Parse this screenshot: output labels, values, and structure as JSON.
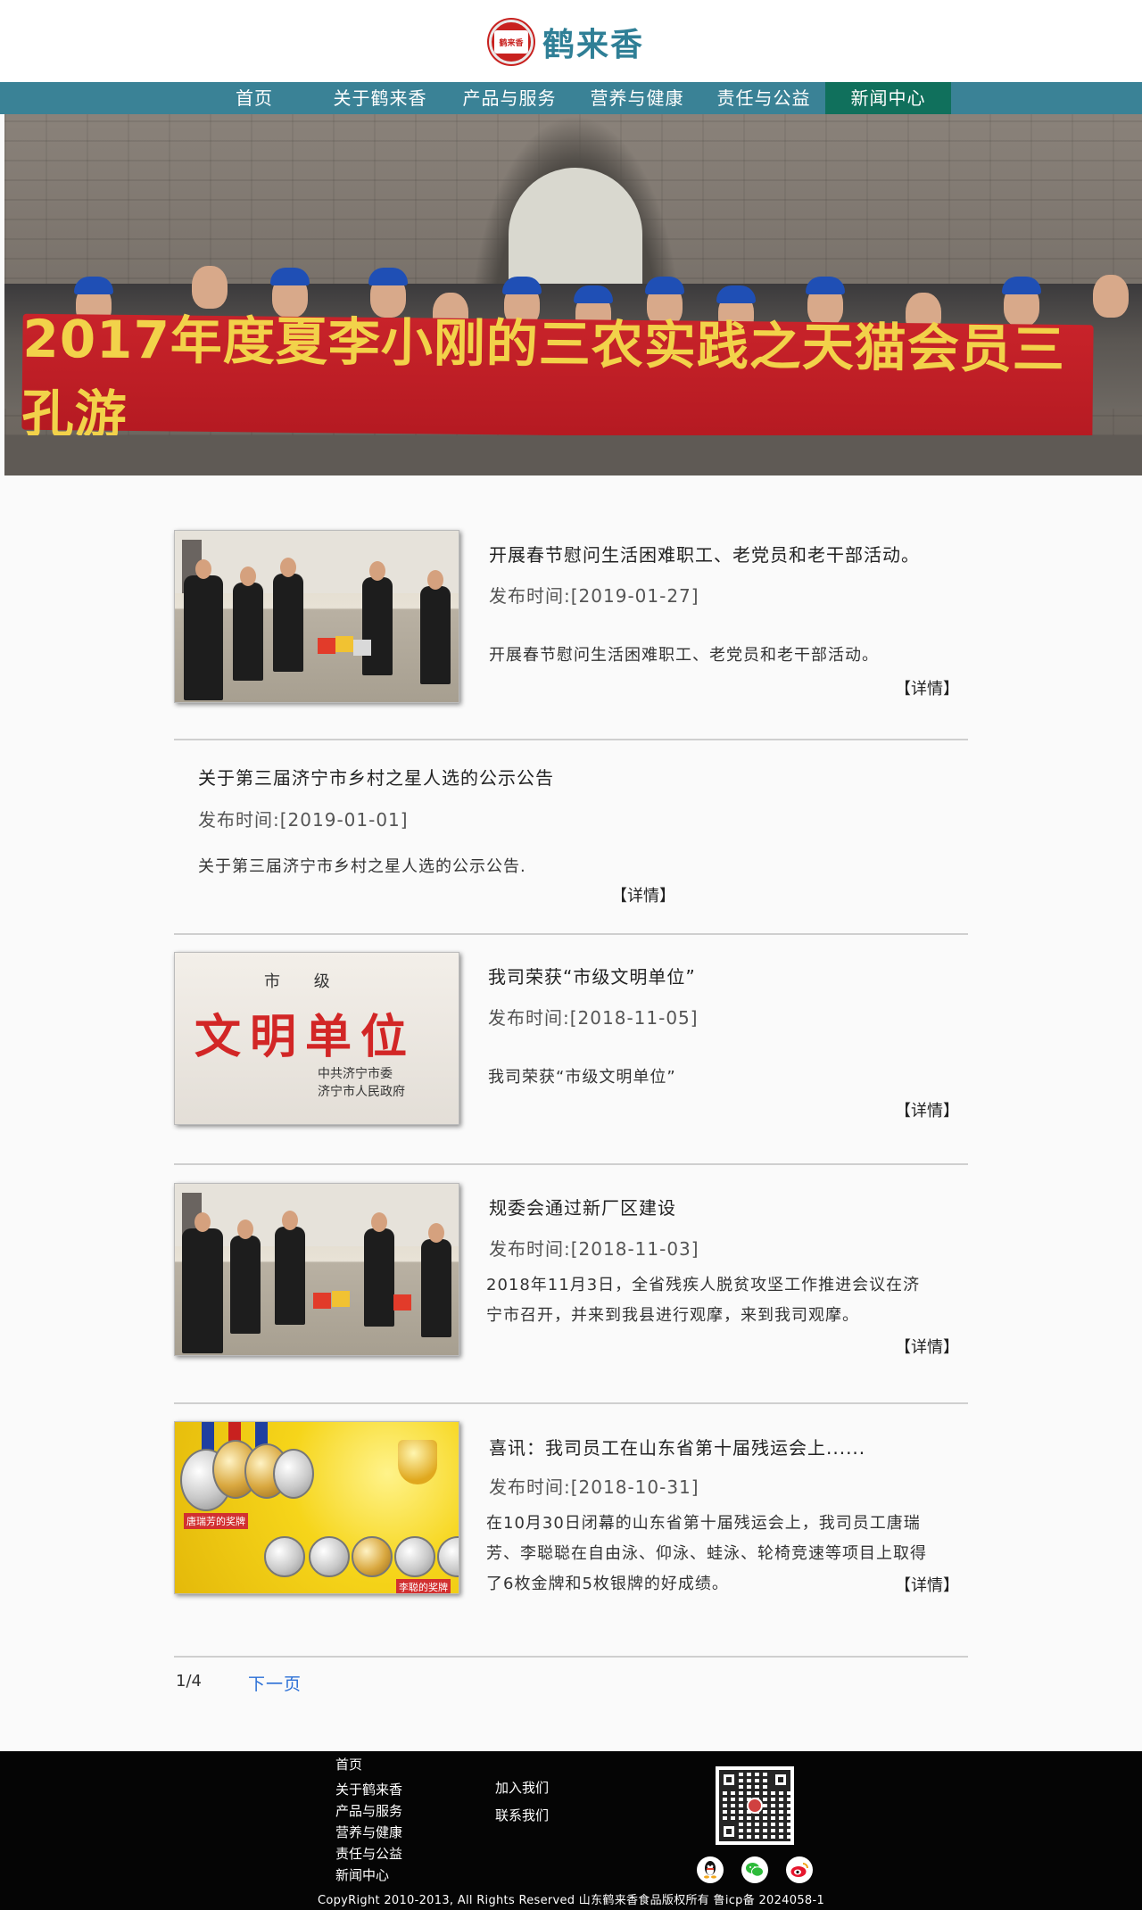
{
  "brand": {
    "name": "鹤来香",
    "badge_text": "鹤来香"
  },
  "nav": {
    "items": [
      {
        "label": "首页"
      },
      {
        "label": "关于鹤来香"
      },
      {
        "label": "产品与服务"
      },
      {
        "label": "营养与健康"
      },
      {
        "label": "责任与公益"
      },
      {
        "label": "新闻中心",
        "active": true
      }
    ]
  },
  "banner": {
    "sign_text": "2017年度夏李小刚的三农实践之天猫会员三孔游"
  },
  "news": [
    {
      "title": "开展春节慰问生活困难职工、老党员和老干部活动。",
      "date": "发布时间:[2019-01-27]",
      "summary": "开展春节慰问生活困难职工、老党员和老干部活动。",
      "more": "【详情】"
    },
    {
      "title": "关于第三届济宁市乡村之星人选的公示公告",
      "date": "发布时间:[2019-01-01]",
      "summary": "关于第三届济宁市乡村之星人选的公示公告.",
      "more": "【详情】"
    },
    {
      "title": "我司荣获“市级文明单位”",
      "date": "发布时间:[2018-11-05]",
      "summary": "我司荣获“市级文明单位”",
      "more": "【详情】",
      "plaque": {
        "top": "市 级",
        "main": "文明单位",
        "issuer1": "中共济宁市委",
        "issuer2": "济宁市人民政府"
      }
    },
    {
      "title": "规委会通过新厂区建设",
      "date": "发布时间:[2018-11-03]",
      "summary": "2018年11月3日，全省残疾人脱贫攻坚工作推进会议在济宁市召开，并来到我县进行观摩，来到我司观摩。",
      "more": "【详情】"
    },
    {
      "title": "喜讯：我司员工在山东省第十届残运会上......",
      "date": "发布时间:[2018-10-31]",
      "summary": "在10月30日闭幕的山东省第十届残运会上，我司员工唐瑞芳、李聪聪在自由泳、仰泳、蛙泳、轮椅竞速等项目上取得了6枚金牌和5枚银牌的好成绩。",
      "more": "【详情】",
      "medal_tags": {
        "left": "唐瑞芳的奖牌",
        "right": "李聪的奖牌"
      }
    }
  ],
  "pager": {
    "count": "1/4",
    "next": "下一页"
  },
  "footer": {
    "col1": [
      "首页",
      "关于鹤来香",
      "产品与服务",
      "营养与健康",
      "责任与公益",
      "新闻中心"
    ],
    "col2": [
      "加入我们",
      "联系我们"
    ],
    "social": [
      "qq-icon",
      "wechat-icon",
      "weibo-icon"
    ],
    "copyright": "CopyRight 2010-2013, All Rights Reserved 山东鹤来香食品版权所有  鲁icp备 2024058-1"
  },
  "colors": {
    "nav_bg": "#3a8296",
    "nav_active": "#10705c",
    "brand_text": "#2f7f96",
    "brand_red": "#c8211f",
    "link_blue": "#2a6fd6"
  }
}
